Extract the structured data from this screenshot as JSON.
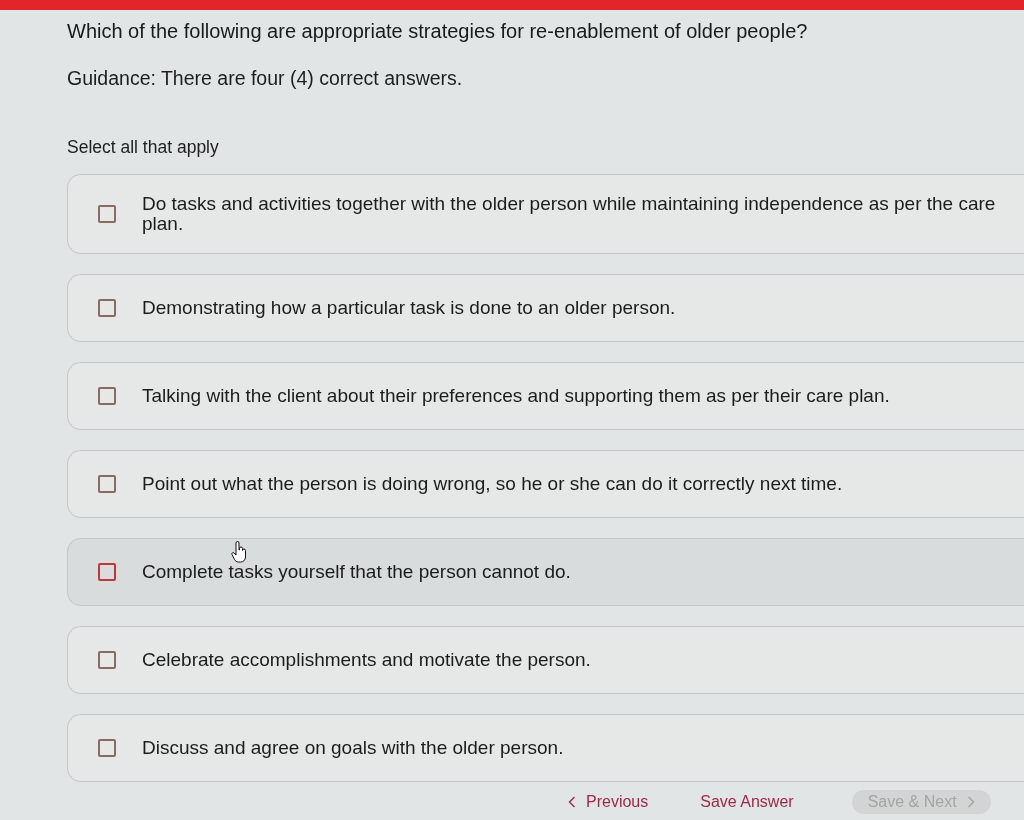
{
  "question": {
    "title": "Which of the following are appropriate strategies for re-enablement of older people?",
    "guidance": "Guidance: There are four (4) correct answers.",
    "instruction": "Select all that apply"
  },
  "options": [
    {
      "text": "Do tasks and activities together with the older person while maintaining independence as per the care plan.",
      "checked": false,
      "hovered": false
    },
    {
      "text": "Demonstrating how a particular task is done to an older person.",
      "checked": false,
      "hovered": false
    },
    {
      "text": "Talking with the client about their preferences and supporting them as per their care plan.",
      "checked": false,
      "hovered": false
    },
    {
      "text": "Point out what the person is doing wrong, so he or she can do it correctly next time.",
      "checked": false,
      "hovered": false
    },
    {
      "text": "Complete tasks yourself that the person cannot do.",
      "checked": false,
      "hovered": true
    },
    {
      "text": "Celebrate accomplishments and motivate the person.",
      "checked": false,
      "hovered": false
    },
    {
      "text": "Discuss and agree on goals with the older person.",
      "checked": false,
      "hovered": false
    }
  ],
  "buttons": [
    {
      "label": "Previous",
      "kind": "prev",
      "disabled": false
    },
    {
      "label": "Save Answer",
      "kind": "save",
      "disabled": false
    },
    {
      "label": "Save & Next",
      "kind": "next",
      "disabled": true
    }
  ]
}
